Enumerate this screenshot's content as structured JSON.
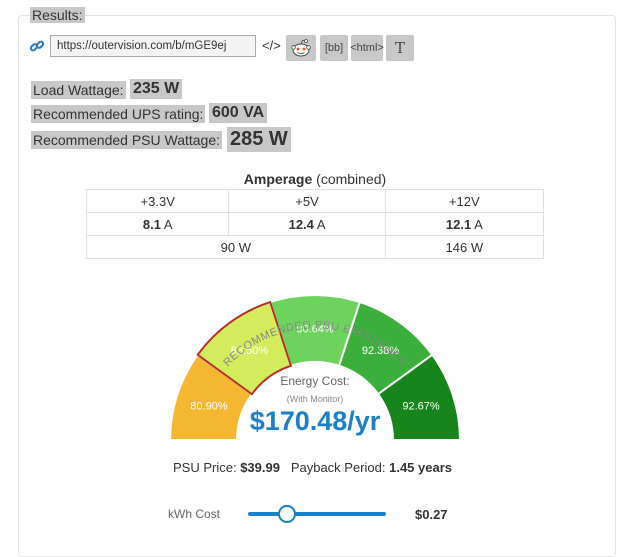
{
  "results": {
    "title": "Results:",
    "url": "https://outervision.com/b/mGE9ej",
    "embed_label": "</>",
    "share_buttons": [
      {
        "name": "reddit-icon",
        "label": ""
      },
      {
        "name": "bbcode-button",
        "label": "[bb]"
      },
      {
        "name": "html-button",
        "label": "<html>"
      },
      {
        "name": "text-button",
        "label": "T"
      }
    ]
  },
  "stats": {
    "load_label": "Load Wattage:",
    "load_value": "235 W",
    "ups_label": "Recommended UPS rating:",
    "ups_value": "600 VA",
    "psu_label": "Recommended PSU Wattage:",
    "psu_value": "285 W"
  },
  "amperage": {
    "title": "Amperage",
    "title_note": "(combined)",
    "headers": [
      "+3.3V",
      "+5V",
      "+12V"
    ],
    "amps": [
      {
        "value": "8.1",
        "unit": "A"
      },
      {
        "value": "12.4",
        "unit": "A"
      },
      {
        "value": "12.1",
        "unit": "A"
      }
    ],
    "watts_combined": "90 W",
    "watts_12v": "146 W"
  },
  "gauge": {
    "arc_label": "RECOMMENDED PSU EFFICIENCY",
    "segments": [
      {
        "label": "80.90%",
        "color": "#f5b731"
      },
      {
        "label": "83.50%",
        "color": "#d4ec5c"
      },
      {
        "label": "90.64%",
        "color": "#6cd45c"
      },
      {
        "label": "92.38%",
        "color": "#3bae3b"
      },
      {
        "label": "92.67%",
        "color": "#17841c"
      }
    ],
    "highlight_color": "#b5302a",
    "recommended_index": 1
  },
  "energy": {
    "label": "Energy Cost:",
    "sub": "(With Monitor)",
    "value": "$170.48/yr"
  },
  "payback": {
    "price_label": "PSU Price:",
    "price_value": "$39.99",
    "period_label": "Payback Period:",
    "period_value": "1.45 years"
  },
  "kwh": {
    "label": "kWh Cost",
    "value": "$0.27",
    "slider_fraction": 0.27
  },
  "colors": {
    "accent": "#1b7fc9",
    "highlight": "#c8c8c8"
  }
}
